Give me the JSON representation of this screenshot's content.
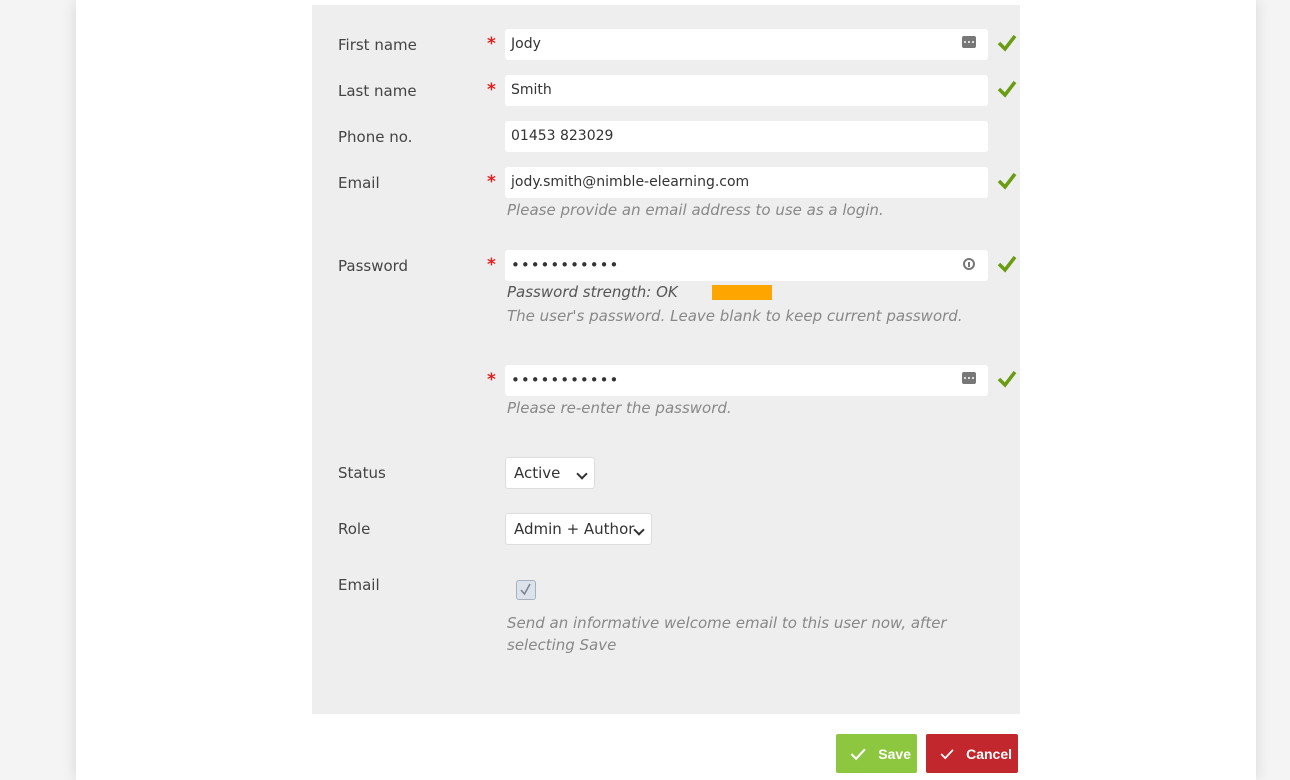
{
  "form": {
    "first_name": {
      "label": "First name",
      "required": "*",
      "value": "Jody"
    },
    "last_name": {
      "label": "Last name",
      "required": "*",
      "value": "Smith"
    },
    "phone": {
      "label": "Phone no.",
      "value": "01453 823029"
    },
    "email": {
      "label": "Email",
      "required": "*",
      "value": "jody.smith@nimble-elearning.com",
      "hint": "Please provide an email address to use as a login."
    },
    "password": {
      "label": "Password",
      "required": "*",
      "value": "•••••••••••",
      "strength_text": "Password strength: OK",
      "strength_level": "OK",
      "hint": "The user's password. Leave blank to keep current password."
    },
    "password_confirm": {
      "required": "*",
      "value": "•••••••••••",
      "hint": "Please re-enter the password."
    },
    "status": {
      "label": "Status",
      "selected": "Active"
    },
    "role": {
      "label": "Role",
      "selected": "Admin + Author"
    },
    "welcome_email": {
      "label": "Email",
      "checked": true,
      "hint_line1": "Send an informative welcome email to this user now, after",
      "hint_line2": "selecting Save"
    }
  },
  "buttons": {
    "save_label": "Save",
    "cancel_label": "Cancel"
  },
  "colors": {
    "panel_bg": "#eeeeee",
    "valid_check": "#6a9c12",
    "required": "#e02020",
    "strength_ok": "#ffa500",
    "save": "#8dc63f",
    "cancel": "#c1272d"
  },
  "icons": {
    "valid": "checkmark-icon",
    "autofill": "autofill-icon",
    "password_manager": "key-icon"
  }
}
